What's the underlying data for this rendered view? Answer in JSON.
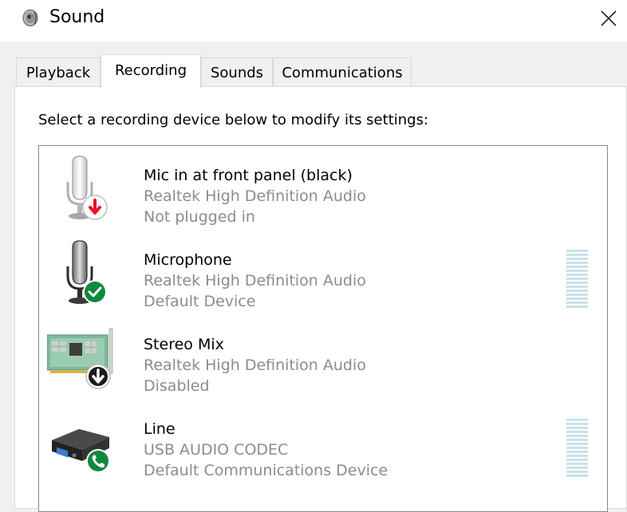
{
  "window": {
    "title": "Sound",
    "title_icon": "speaker-icon",
    "close_icon": "close-icon"
  },
  "tabs": [
    {
      "label": "Playback",
      "active": false
    },
    {
      "label": "Recording",
      "active": true
    },
    {
      "label": "Sounds",
      "active": false
    },
    {
      "label": "Communications",
      "active": false
    }
  ],
  "instruction": "Select a recording device below to modify its settings:",
  "devices": [
    {
      "name": "Mic in at front panel (black)",
      "driver": "Realtek High Definition Audio",
      "status": "Not plugged in",
      "icon": "microphone-icon",
      "badge": "unplugged-arrow-icon",
      "badge_color": "#e81123",
      "level_meter": false
    },
    {
      "name": "Microphone",
      "driver": "Realtek High Definition Audio",
      "status": "Default Device",
      "icon": "microphone-icon",
      "badge": "default-check-icon",
      "badge_color": "#10893e",
      "level_meter": true
    },
    {
      "name": "Stereo Mix",
      "driver": "Realtek High Definition Audio",
      "status": "Disabled",
      "icon": "sound-card-icon",
      "badge": "disabled-arrow-icon",
      "badge_color": "#1b1b1b",
      "level_meter": false
    },
    {
      "name": "Line",
      "driver": "USB AUDIO  CODEC",
      "status": "Default Communications Device",
      "icon": "usb-audio-device-icon",
      "badge": "communications-phone-icon",
      "badge_color": "#10893e",
      "level_meter": true
    }
  ],
  "colors": {
    "meter_bar": "#c9e2e8",
    "secondary_text": "#8c8c8c",
    "list_border": "#828790"
  }
}
